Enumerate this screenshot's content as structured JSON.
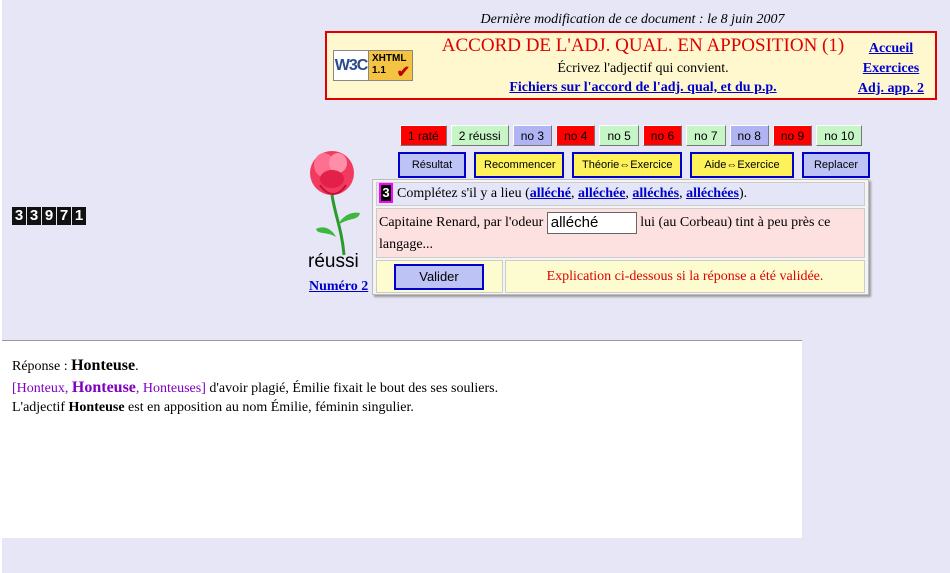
{
  "header": {
    "modification": "Dernière modification de ce document : le 8 juin 2007",
    "title": "ACCORD DE L'ADJ. QUAL. EN APPOSITION (1)",
    "subtitle": "Écrivez l'adjectif qui convient.",
    "files_link": "Fichiers sur l'accord de l'adj. qual, et du p.p.",
    "badge": {
      "w3c": "W3C",
      "xhtml": "XHTML",
      "version": "1.1"
    },
    "nav": [
      "Accueil",
      "Exercices",
      "Adj. app. 2"
    ]
  },
  "counter": [
    "3",
    "3",
    "9",
    "7",
    "1"
  ],
  "rose": {
    "status": "réussi",
    "numero": "Numéro 2"
  },
  "tabs": [
    {
      "label": "1 raté",
      "state": "red"
    },
    {
      "label": "2 réussi",
      "state": "green"
    },
    {
      "label": "no 3",
      "state": "blue"
    },
    {
      "label": "no 4",
      "state": "red"
    },
    {
      "label": "no 5",
      "state": "green"
    },
    {
      "label": "no 6",
      "state": "red"
    },
    {
      "label": "no 7",
      "state": "green"
    },
    {
      "label": "no 8",
      "state": "blue"
    },
    {
      "label": "no 9",
      "state": "red"
    },
    {
      "label": "no 10",
      "state": "green"
    }
  ],
  "actions": [
    "Résultat",
    "Recommencer",
    "Théorie⇔Exercice",
    "Aide⇔Exercice",
    "Replacer"
  ],
  "exercise": {
    "number": "3",
    "instruction": "Complétez s'il y a lieu (",
    "options": [
      "alléché",
      "alléchée",
      "alléchés",
      "alléchées"
    ],
    "instruction_end": ").",
    "sentence_before": "Capitaine Renard, par l'odeur",
    "answer_value": "alléché",
    "sentence_after": "lui (au Corbeau) tint à peu près ce langage...",
    "validate_label": "Valider",
    "explanation": "Explication ci-dessous si la réponse a été validée."
  },
  "answer": {
    "prefix": "Réponse :",
    "word": "Honteuse",
    "period": ".",
    "choices_open": "[Honteux,",
    "choice_main": "Honteuse",
    "choices_close": ", Honteuses]",
    "sentence": "d'avoir plagié, Émilie fixait le bout des ses souliers.",
    "expl_before": "L'adjectif",
    "expl_word": "Honteuse",
    "expl_after": "est en apposition au nom Émilie, féminin singulier."
  },
  "colors": {
    "accent_red": "#e00000",
    "link_blue": "#0000cc",
    "background": "#e6e6f7"
  }
}
